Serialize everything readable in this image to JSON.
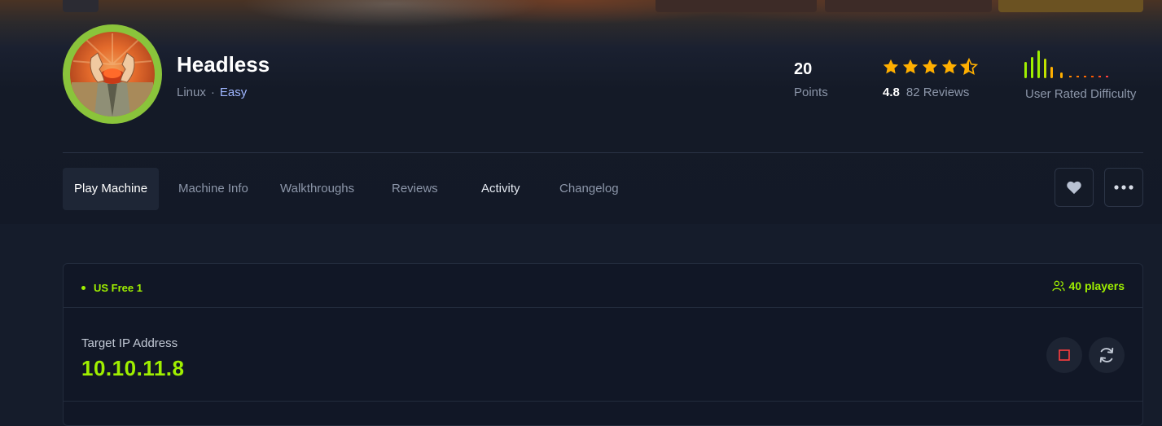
{
  "machine": {
    "name": "Headless",
    "os": "Linux",
    "separator": "·",
    "difficulty": "Easy"
  },
  "stats": {
    "points_value": "20",
    "points_label": "Points",
    "rating_value": "4.8",
    "reviews_label": "82 Reviews",
    "rating_stars": 4.5,
    "difficulty_label": "User Rated Difficulty"
  },
  "tabs": [
    {
      "label": "Play Machine"
    },
    {
      "label": "Machine Info"
    },
    {
      "label": "Walkthroughs"
    },
    {
      "label": "Reviews"
    },
    {
      "label": "Activity"
    },
    {
      "label": "Changelog"
    }
  ],
  "actions": {
    "favorite_icon": "heart-icon",
    "more_icon": "more-horizontal-icon"
  },
  "connection": {
    "server": "US Free 1",
    "players": "40 players",
    "target_label": "Target IP Address",
    "target_ip": "10.10.11.8"
  },
  "colors": {
    "accent_green": "#9fef00",
    "star_orange": "#ffaf00",
    "stop_red": "#ff3e3e",
    "easy_blue": "#9fb6ff"
  }
}
